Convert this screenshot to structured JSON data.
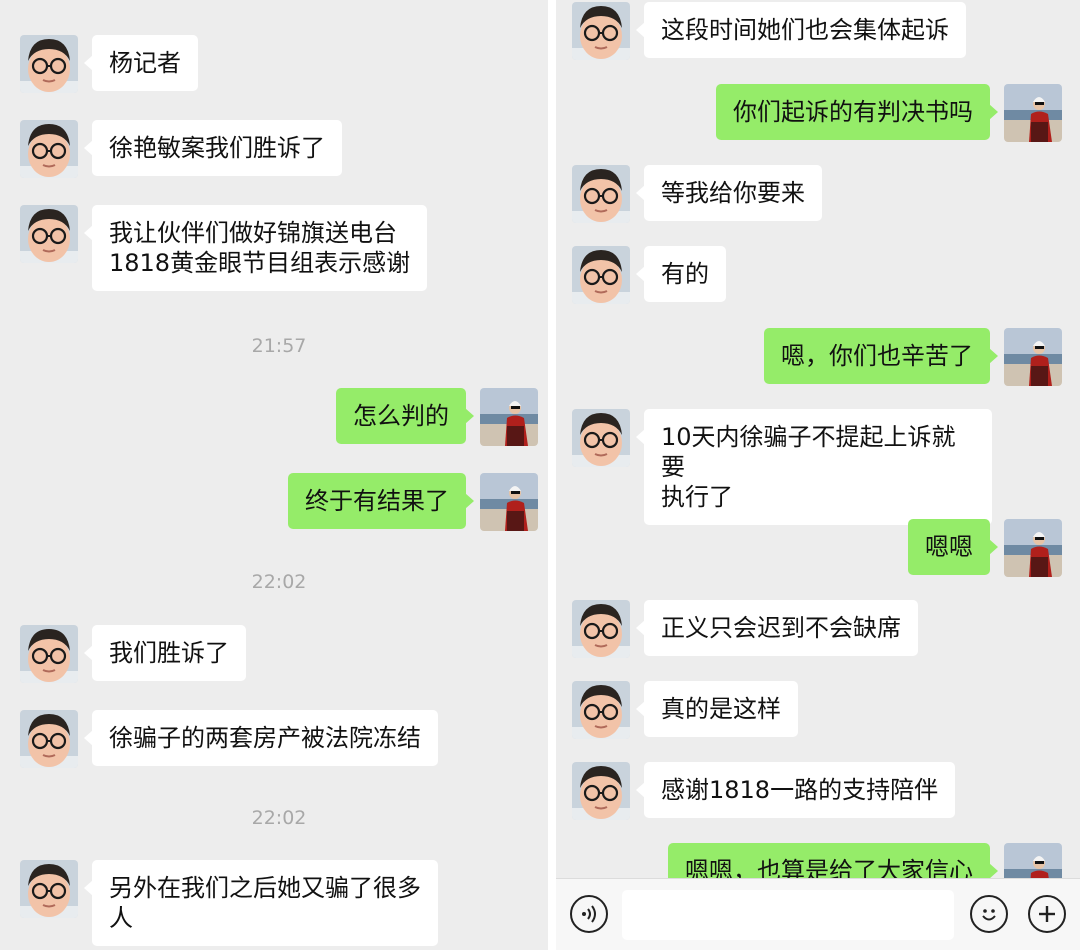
{
  "left_chat": {
    "messages": [
      {
        "side": "in",
        "text": "杨记者"
      },
      {
        "side": "in",
        "text": "徐艳敏案我们胜诉了"
      },
      {
        "side": "in",
        "line1": "我让伙伴们做好锦旗送电台",
        "line2": "1818黄金眼节目组表示感谢"
      },
      {
        "side": "out",
        "text": "怎么判的"
      },
      {
        "side": "out",
        "text": "终于有结果了"
      },
      {
        "side": "in",
        "text": "我们胜诉了"
      },
      {
        "side": "in",
        "text": "徐骗子的两套房产被法院冻结"
      },
      {
        "side": "in",
        "line1": "另外在我们之后她又骗了很多",
        "line2": "人"
      }
    ],
    "timestamps": [
      "21:57",
      "22:02",
      "22:02"
    ]
  },
  "right_chat": {
    "messages": [
      {
        "side": "in",
        "text": "这段时间她们也会集体起诉"
      },
      {
        "side": "out",
        "text": "你们起诉的有判决书吗"
      },
      {
        "side": "in",
        "text": "等我给你要来"
      },
      {
        "side": "in",
        "text": "有的"
      },
      {
        "side": "out",
        "text": "嗯，你们也辛苦了"
      },
      {
        "side": "in",
        "line1": "10天内徐骗子不提起上诉就要",
        "line2": "执行了"
      },
      {
        "side": "out",
        "text": "嗯嗯"
      },
      {
        "side": "in",
        "text": "正义只会迟到不会缺席"
      },
      {
        "side": "in",
        "text": "真的是这样"
      },
      {
        "side": "in",
        "text": "感谢1818一路的支持陪伴"
      },
      {
        "side": "out",
        "text": "嗯嗯，也算是给了大家信心"
      }
    ]
  },
  "input_bar": {
    "icons": [
      "voice-icon",
      "emoji-icon",
      "plus-icon"
    ],
    "input_value": ""
  },
  "colors": {
    "background": "#ededed",
    "incoming_bubble": "#ffffff",
    "outgoing_bubble": "#95ec69",
    "timestamp": "#a8a8a8"
  }
}
